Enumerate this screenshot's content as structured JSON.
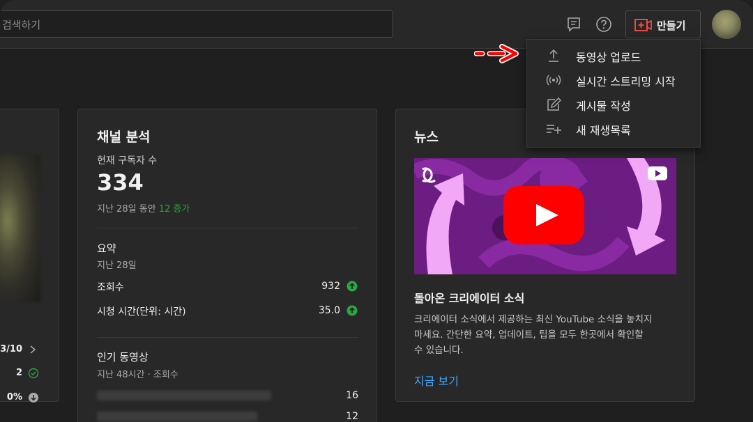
{
  "search": {
    "placeholder": "검색하기"
  },
  "header": {
    "create_label": "만들기"
  },
  "create_menu": {
    "items": [
      {
        "label": "동영상 업로드",
        "icon": "upload-icon"
      },
      {
        "label": "실시간 스트리밍 시작",
        "icon": "live-broadcast-icon"
      },
      {
        "label": "게시물 작성",
        "icon": "edit-post-icon"
      },
      {
        "label": "새 재생목록",
        "icon": "add-playlist-icon"
      }
    ]
  },
  "channel_analytics": {
    "title": "채널 분석",
    "subscribers_label": "현재 구독자 수",
    "subscribers_value": "334",
    "period_text": "지난 28일 동안",
    "change_text": "12 증가",
    "summary_title": "요약",
    "summary_period": "지난 28일",
    "metrics": [
      {
        "label": "조회수",
        "value": "932"
      },
      {
        "label": "시청 시간(단위: 시간)",
        "value": "35.0"
      }
    ],
    "top_videos_title": "인기 동영상",
    "top_videos_period": "지난 48시간 · 조회수",
    "top_videos": [
      {
        "value": "16"
      },
      {
        "value": "12"
      }
    ]
  },
  "left_card": {
    "rows": [
      {
        "value": "3/10",
        "icon": "chevron-right-icon"
      },
      {
        "value": "2",
        "icon": "check-circle-icon"
      },
      {
        "value": "0%",
        "icon": "download-circle-icon"
      }
    ]
  },
  "news": {
    "title": "뉴스",
    "headline": "돌아온 크리에이터 소식",
    "body_lines": [
      "크리에이터 소식에서 제공하는 최신 YouTube 소식을 놓치지",
      "마세요. 간단한 요약, 업데이트, 팁을 모두 한곳에서 확인할",
      "수 있습니다."
    ],
    "cta_label": "지금 보기"
  },
  "colors": {
    "background": "#1f1f1f",
    "card": "#282828",
    "accent_green": "#2ba640",
    "link_blue": "#3ea6ff",
    "youtube_red": "#ff0000",
    "annotation_red": "#ff0000"
  }
}
